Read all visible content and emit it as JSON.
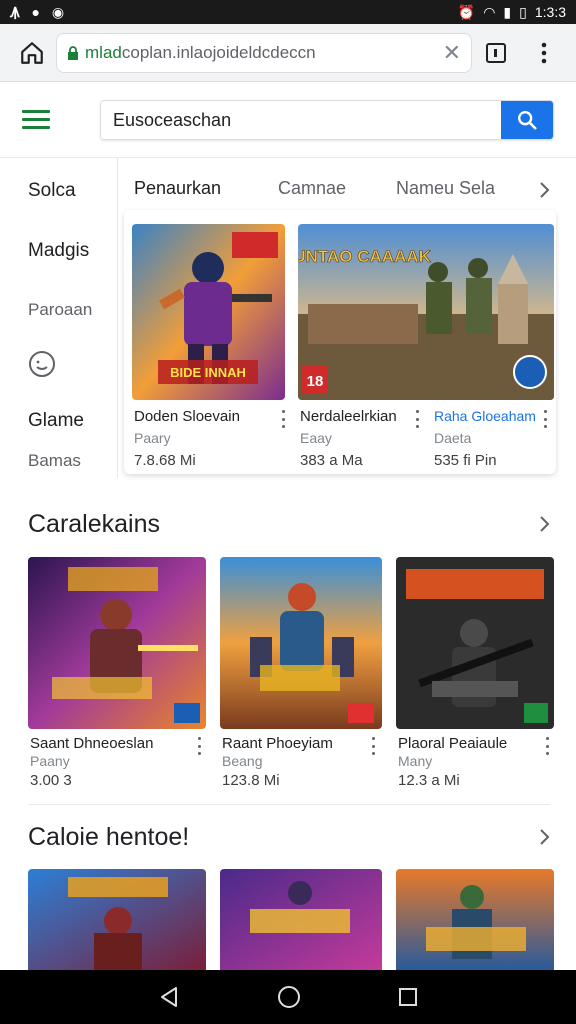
{
  "status_bar": {
    "time": "1:3:3"
  },
  "browser": {
    "url_green": "mlad",
    "url_rest": "coplan.inlaojoideldcdeccn",
    "clear_icon": "close-icon",
    "tab_count": ""
  },
  "search": {
    "value": "Eusoceaschan",
    "placeholder": ""
  },
  "left_nav": [
    "Solca",
    "Madgis",
    "Paroaan",
    "Glame",
    "Bamas"
  ],
  "tabs": [
    "Penaurkan",
    "Camnae",
    "Nameu Sela"
  ],
  "featured": [
    {
      "name": "Doden Sloevain",
      "dev": "Paary",
      "price": "7.8.68 Mi"
    },
    {
      "name": "Nerdaleelrkian",
      "dev": "Eaay",
      "price": "383 a Ma"
    },
    {
      "name": "Raha Gloeaham",
      "dev": "Daeta",
      "price": "535 fi Pin"
    }
  ],
  "featured_banner": {
    "badge_big": "18",
    "title_art": "RUNTAO CAAAAK",
    "hero_art": "BIDE INNAH"
  },
  "section1": {
    "title": "Caralekains",
    "items": [
      {
        "name": "Saant Dhneoeslan",
        "dev": "Paany",
        "price": "3.00 3"
      },
      {
        "name": "Raant Phoeyiam",
        "dev": "Beang",
        "price": "123.8 Mi"
      },
      {
        "name": "Plaoral Peaiaule",
        "dev": "Many",
        "price": "12.3 a Mi"
      }
    ]
  },
  "section2": {
    "title": "Caloie hentoe!"
  },
  "colors": {
    "accent_green": "#188038",
    "accent_blue": "#1a73e8"
  }
}
